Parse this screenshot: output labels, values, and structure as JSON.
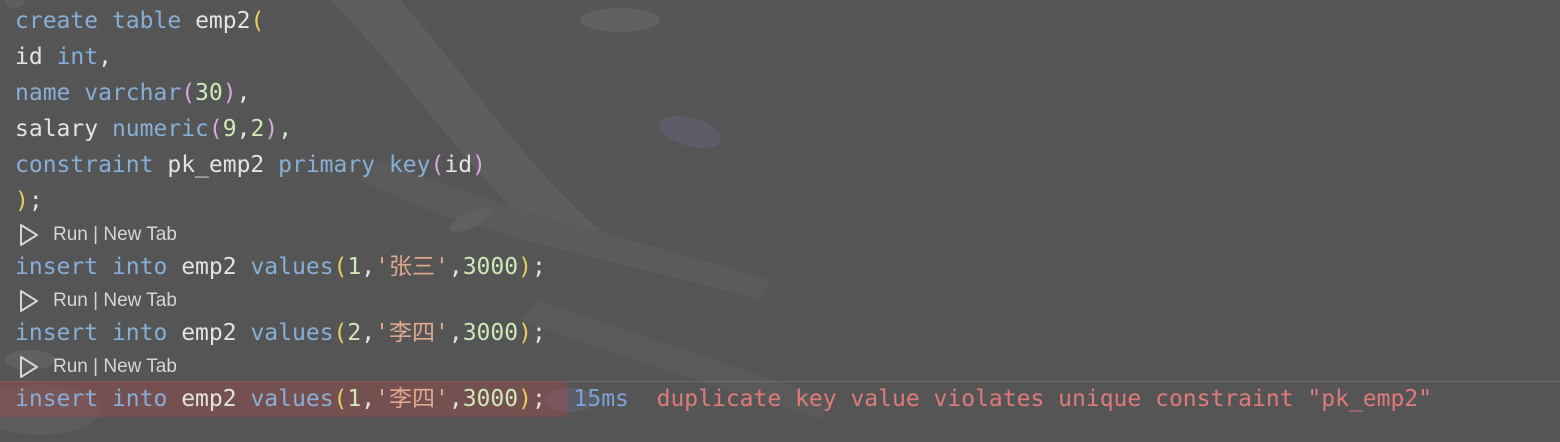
{
  "colors": {
    "background": "#555555",
    "keyword": "#87aed6",
    "identifier": "#e3e3e3",
    "paren_outer": "#e8cf5c",
    "paren_inner": "#d9a7e0",
    "number": "#cfe8b8",
    "string": "#e0a68f",
    "error_text": "#e07a7a",
    "error_highlight": "#c84646",
    "timing": "#7ba3d6"
  },
  "code": {
    "l1": {
      "kw1": "create",
      "kw2": "table",
      "name": "emp2",
      "paren": "("
    },
    "l2": {
      "id": "id",
      "type": "int",
      "comma": ","
    },
    "l3": {
      "name": "name",
      "type": "varchar",
      "p1": "(",
      "num": "30",
      "p2": ")",
      "comma": ","
    },
    "l4": {
      "name": "salary",
      "type": "numeric",
      "p1": "(",
      "num1": "9",
      "comma1": ",",
      "num2": "2",
      "p2": ")",
      "comma": ","
    },
    "l5": {
      "kw": "constraint",
      "cname": "pk_emp2",
      "kw2": "primary",
      "kw3": "key",
      "p1": "(",
      "col": "id",
      "p2": ")"
    },
    "l6": {
      "paren": ")",
      "semi": ";"
    },
    "insert1": {
      "kw1": "insert",
      "kw2": "into",
      "table": "emp2",
      "kw3": "values",
      "p1": "(",
      "n1": "1",
      "c1": ",",
      "s": "'张三'",
      "c2": ",",
      "n2": "3000",
      "p2": ")",
      "semi": ";"
    },
    "insert2": {
      "kw1": "insert",
      "kw2": "into",
      "table": "emp2",
      "kw3": "values",
      "p1": "(",
      "n1": "2",
      "c1": ",",
      "s": "'李四'",
      "c2": ",",
      "n2": "3000",
      "p2": ")",
      "semi": ";"
    },
    "insert3": {
      "kw1": "insert",
      "kw2": "into",
      "table": "emp2",
      "kw3": "values",
      "p1": "(",
      "n1": "1",
      "c1": ",",
      "s": "'李四'",
      "c2": ",",
      "n2": "3000",
      "p2": ")",
      "semi": ";"
    }
  },
  "codelens": {
    "run": "Run",
    "sep": " | ",
    "new_tab": "New Tab"
  },
  "result": {
    "timing": "15ms",
    "error": "duplicate key value violates unique constraint \"pk_emp2\""
  }
}
